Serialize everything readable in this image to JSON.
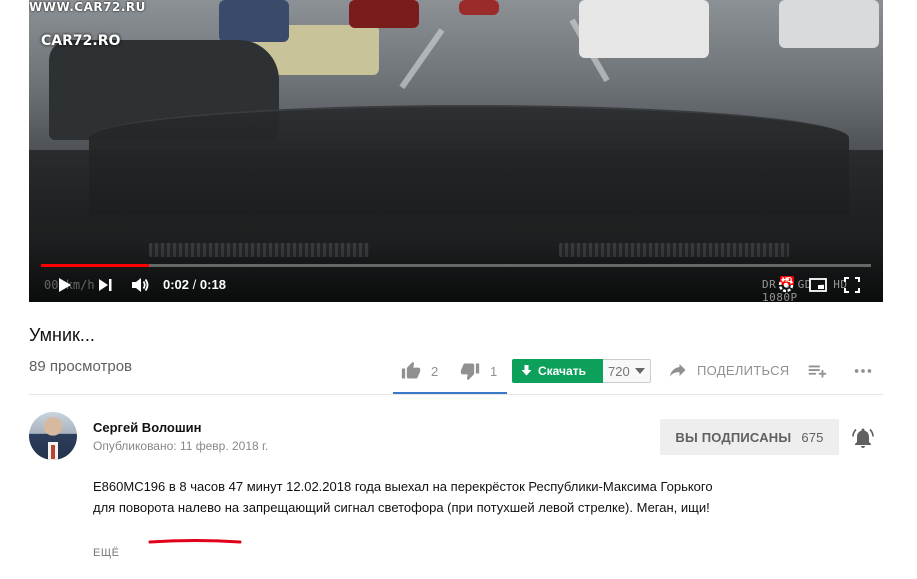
{
  "watermark": {
    "top_text": "WWW.CAR72.RU",
    "logo_text": "CAR72.RO"
  },
  "player": {
    "current_time": "0:02",
    "separator": "/",
    "duration": "0:18",
    "progress": 0.13,
    "overlay_left": "00 km/h",
    "overlay_right": "DR   6 GD - HD 1080P",
    "hd_badge": "HD",
    "icons": [
      "play-icon",
      "next-icon",
      "volume-icon",
      "settings-icon",
      "miniplayer-icon",
      "fullscreen-icon"
    ]
  },
  "video": {
    "title": "Умник...",
    "views": "89 просмотров",
    "likes": "2",
    "dislikes": "1",
    "download_label": "Скачать",
    "quality": "720",
    "share_label": "ПОДЕЛИТЬСЯ"
  },
  "channel": {
    "name": "Сергей Волошин",
    "published": "Опубликовано: 11 февр. 2018 г.",
    "subscribed_label": "ВЫ ПОДПИСАНЫ",
    "subscriber_count": "675"
  },
  "description": {
    "text": "Е860МС196 в 8 часов 47 минут 12.02.2018 года выехал на перекрёсток Республики-Максима Горького для поворота налево на запрещающий сигнал светофора (при потухшей левой стрелке). Меган, ищи!",
    "more_label": "ЕЩЁ"
  },
  "colors": {
    "progress_played": "#ff0000",
    "download_button": "#0da05a",
    "like_underline": "#1565c0",
    "annotation_underline": "#e0001b"
  }
}
